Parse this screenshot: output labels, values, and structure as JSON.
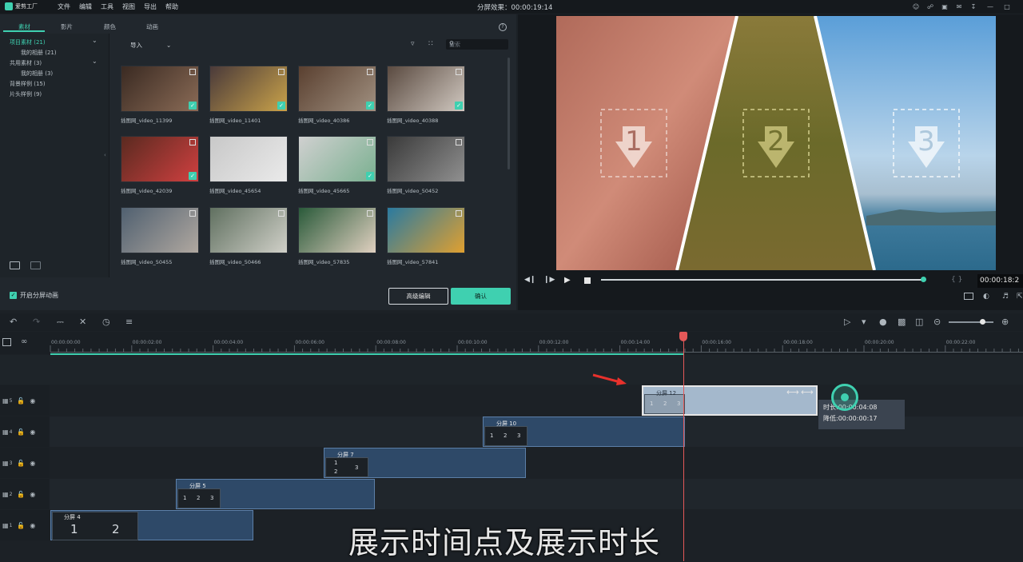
{
  "app": {
    "logo_text": "爱剪工厂",
    "project_title": "分屏效果：00:00:19:14"
  },
  "menu": [
    "文件",
    "编辑",
    "工具",
    "视图",
    "导出",
    "帮助"
  ],
  "library": {
    "tabs": [
      "素材",
      "影片",
      "颜色",
      "动画"
    ],
    "folders": [
      {
        "label": "项目素材 (21)",
        "indent": false,
        "active": true
      },
      {
        "label": "我的相册 (21)",
        "indent": true
      },
      {
        "label": "共用素材 (3)",
        "indent": false
      },
      {
        "label": "我的相册 (3)",
        "indent": true
      },
      {
        "label": "背景样例 (15)",
        "indent": false
      },
      {
        "label": "片头样例 (9)",
        "indent": false
      }
    ],
    "import_label": "导入",
    "search_placeholder": "搜索",
    "thumbnails": [
      {
        "caption": "插图网_video_11399",
        "checked": true,
        "c1": "#3a2a22",
        "c2": "#8a6b56"
      },
      {
        "caption": "插图网_video_11401",
        "checked": true,
        "c1": "#4a3a3a",
        "c2": "#c9a24a"
      },
      {
        "caption": "插图网_video_40386",
        "checked": true,
        "c1": "#5a4030",
        "c2": "#a09080"
      },
      {
        "caption": "插图网_video_40388",
        "checked": true,
        "c1": "#5a4a40",
        "c2": "#d0c8c0"
      },
      {
        "caption": "插图网_video_42039",
        "checked": true,
        "c1": "#5a2a20",
        "c2": "#d04040"
      },
      {
        "caption": "插图网_video_45654",
        "checked": false,
        "c1": "#c8c8c8",
        "c2": "#eaeaea"
      },
      {
        "caption": "插图网_video_45665",
        "checked": true,
        "c1": "#d0d0d0",
        "c2": "#7ab090"
      },
      {
        "caption": "插图网_video_50452",
        "checked": false,
        "c1": "#3a3a3a",
        "c2": "#909090"
      },
      {
        "caption": "插图网_video_50455",
        "checked": false,
        "c1": "#506070",
        "c2": "#b0a8a0"
      },
      {
        "caption": "插图网_video_50466",
        "checked": false,
        "c1": "#607060",
        "c2": "#d0d0c8"
      },
      {
        "caption": "插图网_video_57835",
        "checked": false,
        "c1": "#2a5a3a",
        "c2": "#e0d0c0"
      },
      {
        "caption": "插图网_video_57841",
        "checked": false,
        "c1": "#2a7aa0",
        "c2": "#e0a030"
      }
    ],
    "split_animation_label": "开启分屏动画",
    "advanced_edit_label": "高级编辑",
    "confirm_label": "确认"
  },
  "preview": {
    "panel_numbers": [
      "1",
      "2",
      "3"
    ],
    "timecode": "00:00:18:2",
    "progress": 0.99
  },
  "timeline": {
    "ruler_labels": [
      "00:00:00:00",
      "00:00:02:00",
      "00:00:04:00",
      "00:00:06:00",
      "00:00:08:00",
      "00:00:10:00",
      "00:00:12:00",
      "00:00:14:00",
      "00:00:16:00",
      "00:00:18:00",
      "00:00:20:00",
      "00:00:22:00"
    ],
    "tracks": [
      {
        "id": "5",
        "clip": {
          "title": "分屏 12",
          "nums": [
            "1",
            "2",
            "3"
          ]
        }
      },
      {
        "id": "4",
        "clip": {
          "title": "分屏 10",
          "nums": [
            "1",
            "2",
            "3"
          ]
        }
      },
      {
        "id": "3",
        "clip": {
          "title": "分屏 7",
          "nums": [
            "1",
            "2",
            "3"
          ]
        }
      },
      {
        "id": "2",
        "clip": {
          "title": "分屏 5",
          "nums": [
            "1",
            "2",
            "3"
          ]
        }
      },
      {
        "id": "1",
        "clip": {
          "title": "分屏 4",
          "nums": [
            "1",
            "2"
          ]
        }
      }
    ],
    "tooltip": {
      "duration": "时长:00:00:04:08",
      "delta": "降低:00:00:00:17"
    }
  },
  "subtitle": "展示时间点及展示时长",
  "colors": {
    "accent": "#3fd0b0",
    "playhead": "#e45858",
    "clip": "#2e4968"
  }
}
